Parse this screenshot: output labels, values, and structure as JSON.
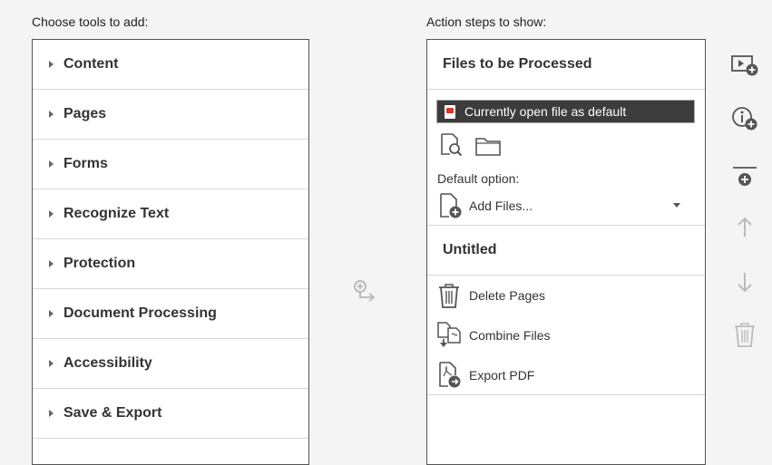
{
  "left_heading": "Choose tools to add:",
  "right_heading": "Action steps to show:",
  "tools": [
    {
      "label": "Content"
    },
    {
      "label": "Pages"
    },
    {
      "label": "Forms"
    },
    {
      "label": "Recognize Text"
    },
    {
      "label": "Protection"
    },
    {
      "label": "Document Processing"
    },
    {
      "label": "Accessibility"
    },
    {
      "label": "Save & Export"
    }
  ],
  "files_section": {
    "title": "Files to be Processed",
    "selected_file": "Currently open file as default",
    "default_option_label": "Default option:",
    "add_files": "Add Files..."
  },
  "group": {
    "title": "Untitled",
    "steps": [
      {
        "label": "Delete Pages",
        "icon": "trash-icon"
      },
      {
        "label": "Combine Files",
        "icon": "combine-files-icon"
      },
      {
        "label": "Export PDF",
        "icon": "export-pdf-icon"
      }
    ]
  },
  "side_buttons": [
    "add-instruction-step-icon",
    "add-information-icon",
    "add-panel-icon",
    "move-up-icon",
    "move-down-icon",
    "delete-icon"
  ]
}
